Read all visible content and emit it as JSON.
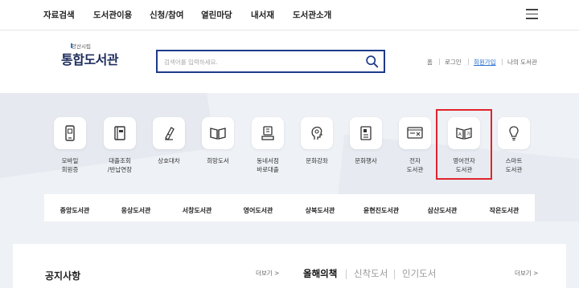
{
  "topnav": {
    "items": [
      "자료검색",
      "도서관이용",
      "신청/참여",
      "열린마당",
      "내서재",
      "도서관소개"
    ]
  },
  "logo": {
    "sub": "양산시립",
    "main": "통합도서관"
  },
  "search": {
    "placeholder": "검색어를 입력하세요."
  },
  "util": {
    "home": "홈",
    "login": "로그인",
    "join": "회원가입",
    "mylib": "나의 도서관"
  },
  "quick_menu": [
    {
      "label": "모바일\n회원증",
      "icon": "mobile-card-icon"
    },
    {
      "label": "대출조회\n/반납연장",
      "icon": "book-loan-icon"
    },
    {
      "label": "상호대차",
      "icon": "pen-exchange-icon"
    },
    {
      "label": "희망도서",
      "icon": "open-book-icon"
    },
    {
      "label": "동네서점\n바로대출",
      "icon": "bookstore-icon"
    },
    {
      "label": "문화강좌",
      "icon": "head-lecture-icon"
    },
    {
      "label": "문화행사",
      "icon": "event-document-icon"
    },
    {
      "label": "전자\n도서관",
      "icon": "monitor-icon"
    },
    {
      "label": "영어전자\n도서관",
      "icon": "english-ebook-icon"
    },
    {
      "label": "스마트\n도서관",
      "icon": "lightbulb-icon"
    }
  ],
  "branches": [
    {
      "label": "중앙도서관",
      "color": "#e8604c"
    },
    {
      "label": "웅상도서관",
      "color": "#f39a3d"
    },
    {
      "label": "서창도서관",
      "color": "#8a5cd6"
    },
    {
      "label": "영어도서관",
      "color": "#4caf50"
    },
    {
      "label": "상북도서관",
      "color": "#2a7fd4"
    },
    {
      "label": "윤현진도서관",
      "color": "#2e3a8c"
    },
    {
      "label": "삼산도서관",
      "color": "#1e9ab0"
    },
    {
      "label": "작은도서관",
      "color": "#9aa3ae"
    }
  ],
  "notice": {
    "title": "공지사항",
    "more": "더보기 >"
  },
  "book_tabs": {
    "active": "올해의책",
    "tab2": "신착도서",
    "tab3": "인기도서",
    "more": "더보기 >"
  }
}
